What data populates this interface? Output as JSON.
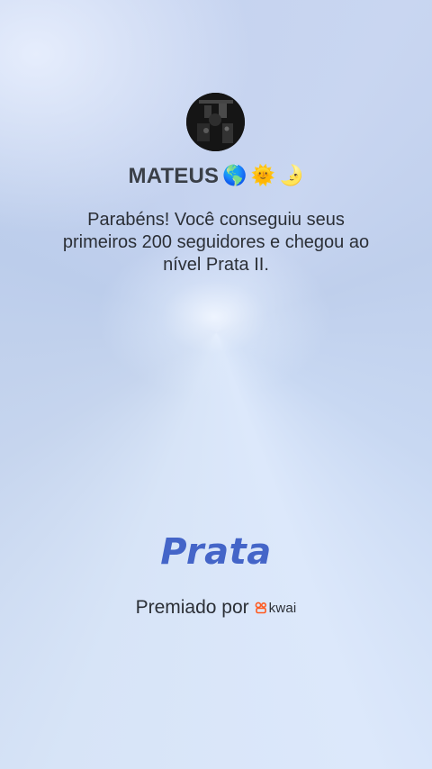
{
  "profile": {
    "username": "MATEUS",
    "emojis": [
      "🌎",
      "🌞",
      "🌛"
    ]
  },
  "message": {
    "text": "Parabéns! Você conseguiu seus primeiros 200 seguidores e chegou ao nível Prata II."
  },
  "level": {
    "title": "Prata"
  },
  "award": {
    "label": "Premiado por",
    "brand": "kwai",
    "brand_icon": "kwai-logo-icon",
    "brand_color": "#ff5a1f"
  },
  "colors": {
    "level_title": "#4465c8",
    "text": "#2b2f36",
    "username": "#3a3f47"
  }
}
